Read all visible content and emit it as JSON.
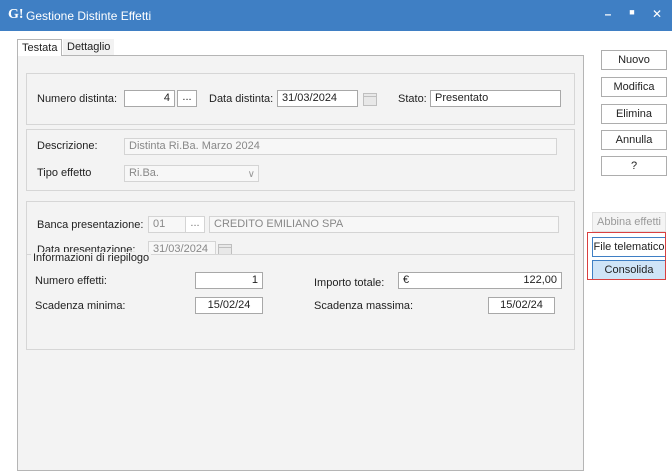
{
  "window": {
    "logo": "G!",
    "title": "Gestione Distinte Effetti",
    "minimize": "–",
    "maximize": "■",
    "close": "✕"
  },
  "tabs": [
    {
      "label": "Testata"
    },
    {
      "label": "Dettaglio Effetti"
    }
  ],
  "header": {
    "numero_label": "Numero distinta:",
    "numero_value": "4",
    "data_label": "Data distinta:",
    "data_value": "31/03/2024",
    "stato_label": "Stato:",
    "stato_value": "Presentato"
  },
  "descrizione": {
    "descrizione_label": "Descrizione:",
    "descrizione_value": "Distinta Ri.Ba. Marzo 2024",
    "tipo_label": "Tipo effetto",
    "tipo_value": "Ri.Ba."
  },
  "banca": {
    "banca_label": "Banca presentazione:",
    "banca_code": "01",
    "banca_name": "CREDITO EMILIANO SPA",
    "data_label": "Data presentazione:",
    "data_value": "31/03/2024"
  },
  "riepilogo": {
    "title": "Informazioni di riepilogo",
    "numero_effetti_label": "Numero effetti:",
    "numero_effetti_value": "1",
    "importo_label": "Importo totale:",
    "currency": "€",
    "importo_value": "122,00",
    "scadenza_min_label": "Scadenza minima:",
    "scadenza_min_value": "15/02/24",
    "scadenza_max_label": "Scadenza massima:",
    "scadenza_max_value": "15/02/24"
  },
  "actions": {
    "nuovo": "Nuovo",
    "modifica": "Modifica",
    "elimina": "Elimina",
    "annulla": "Annulla",
    "help": "?",
    "abbina": "Abbina effetti",
    "file_telematico": "File telematico",
    "consolida": "Consolida"
  },
  "dots": "..."
}
